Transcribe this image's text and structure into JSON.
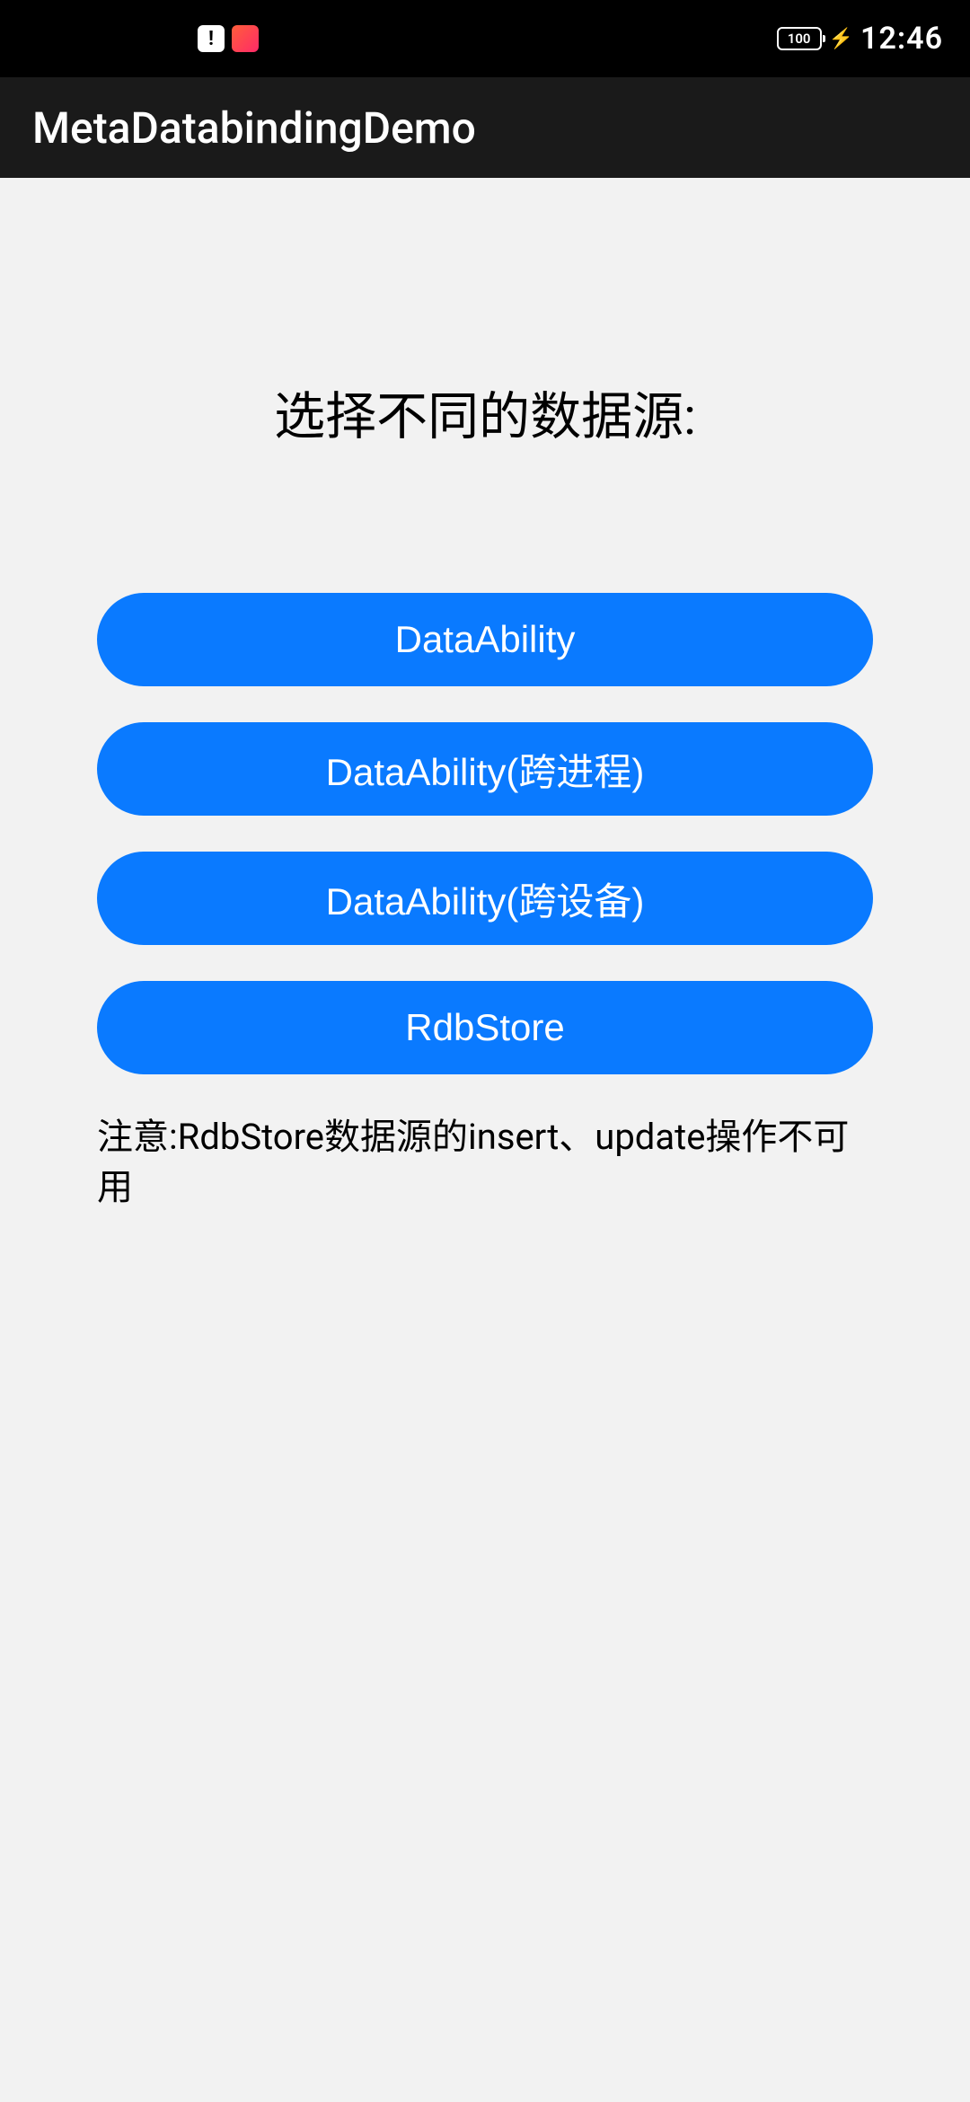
{
  "status_bar": {
    "battery_text": "100",
    "clock": "12:46"
  },
  "app_bar": {
    "title": "MetaDatabindingDemo"
  },
  "main": {
    "heading": "选择不同的数据源:",
    "buttons": [
      {
        "label": "DataAbility"
      },
      {
        "label": "DataAbility(跨进程)"
      },
      {
        "label": "DataAbility(跨设备)"
      },
      {
        "label": "RdbStore"
      }
    ],
    "note": "注意:RdbStore数据源的insert、update操作不可用"
  }
}
